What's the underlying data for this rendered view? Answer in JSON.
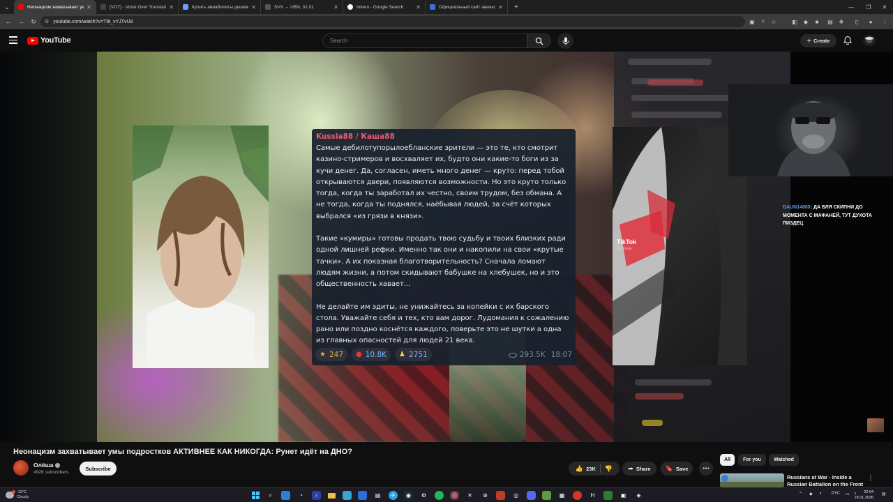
{
  "browser": {
    "tabs": [
      {
        "title": "Неонацизм захватывает умы п",
        "color": "#ff0000",
        "active": true
      },
      {
        "title": "[VOT] - Voice Over Translation",
        "color": "#222222",
        "active": false
      },
      {
        "title": "Купить авиабилеты дешево он",
        "color": "#6aa0ff",
        "active": false
      },
      {
        "title": "SVX → UBN, 31.01",
        "color": "#333333",
        "active": false
      },
      {
        "title": "Inkero - Google Search",
        "color": "#ffffff",
        "active": false
      },
      {
        "title": "Официальный сайт авиакомп",
        "color": "#3b6fe0",
        "active": false
      }
    ],
    "url": "youtube.com/watch?v=T9t_vYJTvU8"
  },
  "header": {
    "logo_text": "YouTube",
    "search_placeholder": "Search",
    "create_label": "Create"
  },
  "player": {
    "post": {
      "author": "Kussia88 / Каша88",
      "paragraphs": [
        "Самые дебилотупорылоебланские зрители — это те, кто смотрит казино-стримеров и восхваляет их, будто они какие-то боги из за кучи денег. Да, согласен, иметь много денег — круто: перед тобой открываются двери, появляются возможности. Но это круто только тогда, когда ты заработал их честно, своим трудом, без обмана. А не тогда, когда ты поднялся, наёбывая людей, за счёт которых выбрался «из грязи в князи».",
        "Такие «кумиры» готовы продать твою судьбу и твоих близких ради одной лишней рефки. Именно так они и накопили на свои «крутые тачки». А их показная благотворительность? Сначала ломают людям жизни, а потом скидывают бабушке на хлебушек, но и это общественность хавает...",
        "Не делайте им эдиты, не унижайтесь за копейки с их барского стола. Уважайте себя и тех, кто вам дорог. Лудомания к сожалению рано или поздно коснётся каждого, поверьте это не шутки а одна из главных опасностей для людей 21 века."
      ],
      "reactions": [
        {
          "emoji": "★",
          "count": "247",
          "gold": true
        },
        {
          "emoji": "●",
          "count": "10.8K",
          "gold": false
        },
        {
          "emoji": "♟",
          "count": "2751",
          "gold": false
        }
      ],
      "views": "293.5K",
      "time": "18:07"
    },
    "chat_message": {
      "user": "DAUN14880",
      "text": ": ДА БЛЯ СКИПНИ ДО МОМЕНТА С МАФАНЕЙ, ТУТ ДУХОТА ПИЗДЕЦ"
    },
    "tiktok_mark": "TikTok",
    "tiktok_handle": "@kussia"
  },
  "video": {
    "title": "Неонацизм захватывает умы подростков АКТИВНЕЕ КАК НИКОГДА: Рунет идёт на ДНО?",
    "channel": "Олёша",
    "subscribers": "492K subscribers",
    "subscribe_label": "Subscribe",
    "likes": "23K",
    "share_label": "Share",
    "save_label": "Save"
  },
  "recommendations": {
    "chips": [
      "All",
      "For you",
      "Watched"
    ],
    "first_title": "Russians at War - Inside a Russian Battalion on the Front"
  },
  "taskbar": {
    "weather_temp": "-13°C",
    "weather_desc": "Cloudy",
    "lang": "РУС",
    "time": "22:04",
    "date": "19.01.2026"
  }
}
